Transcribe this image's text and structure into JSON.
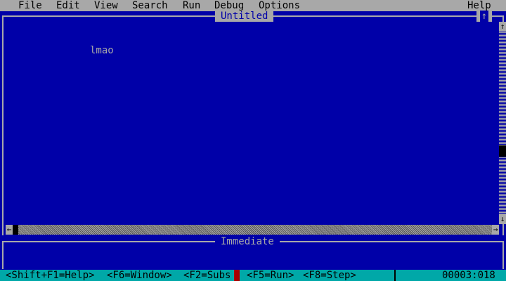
{
  "menu": {
    "items": [
      "File",
      "Edit",
      "View",
      "Search",
      "Run",
      "Debug",
      "Options"
    ],
    "help": "Help"
  },
  "editor": {
    "title": "Untitled",
    "text": "lmao",
    "maximize_glyph": "↑"
  },
  "immediate": {
    "title": "Immediate"
  },
  "scroll": {
    "up": "↑",
    "down": "↓",
    "left": "←",
    "right": "→"
  },
  "status": {
    "hints": [
      "<Shift+F1=Help>",
      "<F6=Window>",
      "<F2=Subs",
      "<F5=Run>",
      "<F8=Step>"
    ],
    "position": "00003:018"
  },
  "colors": {
    "background": "#0000a8",
    "chrome": "#a8a8a8",
    "status_bar": "#00a8a8",
    "cursor": "#a80000"
  }
}
